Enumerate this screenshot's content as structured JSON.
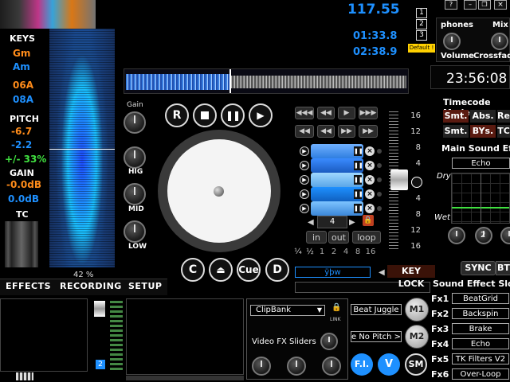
{
  "colors": {
    "accent": "#1e90ff",
    "orange": "#ff8c1a",
    "green": "#40e040",
    "keylock": "#d04020",
    "bpm": "#1e90ff"
  },
  "left_panel": {
    "keys_label": "KEYS",
    "key1": "Gm",
    "key2": "Am",
    "key3": "06A",
    "key4": "08A",
    "pitch_label": "PITCH",
    "pitch1": "-6.7",
    "pitch2": "-2.2",
    "pitch3": "+/- 33%",
    "gain_label": "GAIN",
    "gain1": "-0.0dB",
    "gain2": "0.0dB",
    "tc_label": "TC",
    "percent": "42 %"
  },
  "header": {
    "bpm": "117.55",
    "time_elapsed": "01:33.8",
    "time_remaining": "02:38.9"
  },
  "deck_buttons": {
    "deck1": "1",
    "deck2": "2",
    "deck3": "3",
    "default_label": "Default !"
  },
  "window_controls": {
    "help": "?",
    "minimize": "–",
    "restore": "❐",
    "max": "□",
    "close": "×"
  },
  "phones": {
    "phones_label": "phones",
    "mix_label": "Mix",
    "volume_label": "Volume",
    "crossfade_label": "Crossfade"
  },
  "clock": "23:56:08",
  "timecode": {
    "title": "Timecode Mode",
    "smt1": "Smt.",
    "abs": "Abs.",
    "rel": "Re",
    "smt2": "Smt.",
    "bys": "BYs.",
    "tc": "TC"
  },
  "main_effect": {
    "title": "Main Sound Effect",
    "selected": "Echo",
    "dry": "Dry",
    "wet": "Wet",
    "knob_value": "2"
  },
  "eq": {
    "gain": "Gain",
    "hig": "HIG",
    "mid": "MID",
    "low": "LOW"
  },
  "transport": {
    "r": "R",
    "c": "C",
    "cue": "Cue",
    "d": "D"
  },
  "loop": {
    "count": "4",
    "in": "in",
    "out": "out",
    "loop": "loop",
    "beats": [
      "¼",
      "½",
      "1",
      "2",
      "4",
      "8",
      "16"
    ]
  },
  "pitch_scale": [
    "16",
    "12",
    "8",
    "4",
    "0",
    "4",
    "8",
    "12",
    "16"
  ],
  "bottom_deck": {
    "text_field": "ÿþw",
    "key_lock": "KEY LOCK"
  },
  "tabs": {
    "effects": "EFFECTS",
    "recording": "RECORDING",
    "setup": "SETUP"
  },
  "sync": {
    "sync": "SYNC",
    "bt": "BT"
  },
  "sound_effect_slots": {
    "title": "Sound Effect Slots",
    "slots": [
      {
        "label": "Fx1",
        "value": "BeatGrid"
      },
      {
        "label": "Fx2",
        "value": "Backspin"
      },
      {
        "label": "Fx3",
        "value": "Brake"
      },
      {
        "label": "Fx4",
        "value": "Echo"
      },
      {
        "label": "Fx5",
        "value": "TK Filters V2"
      },
      {
        "label": "Fx6",
        "value": "Over-Loop"
      }
    ]
  },
  "clipbank": {
    "selected": "ClipBank",
    "link": "LINK",
    "video_fx": "Video FX Sliders"
  },
  "bottom_right": {
    "beat_juggle": "Beat Juggle",
    "no_pitch": "e No Pitch >",
    "m1": "M1",
    "m2": "M2",
    "fi": "F.I.",
    "v": "V",
    "sm": "SM"
  },
  "deck_number_badge": "2"
}
